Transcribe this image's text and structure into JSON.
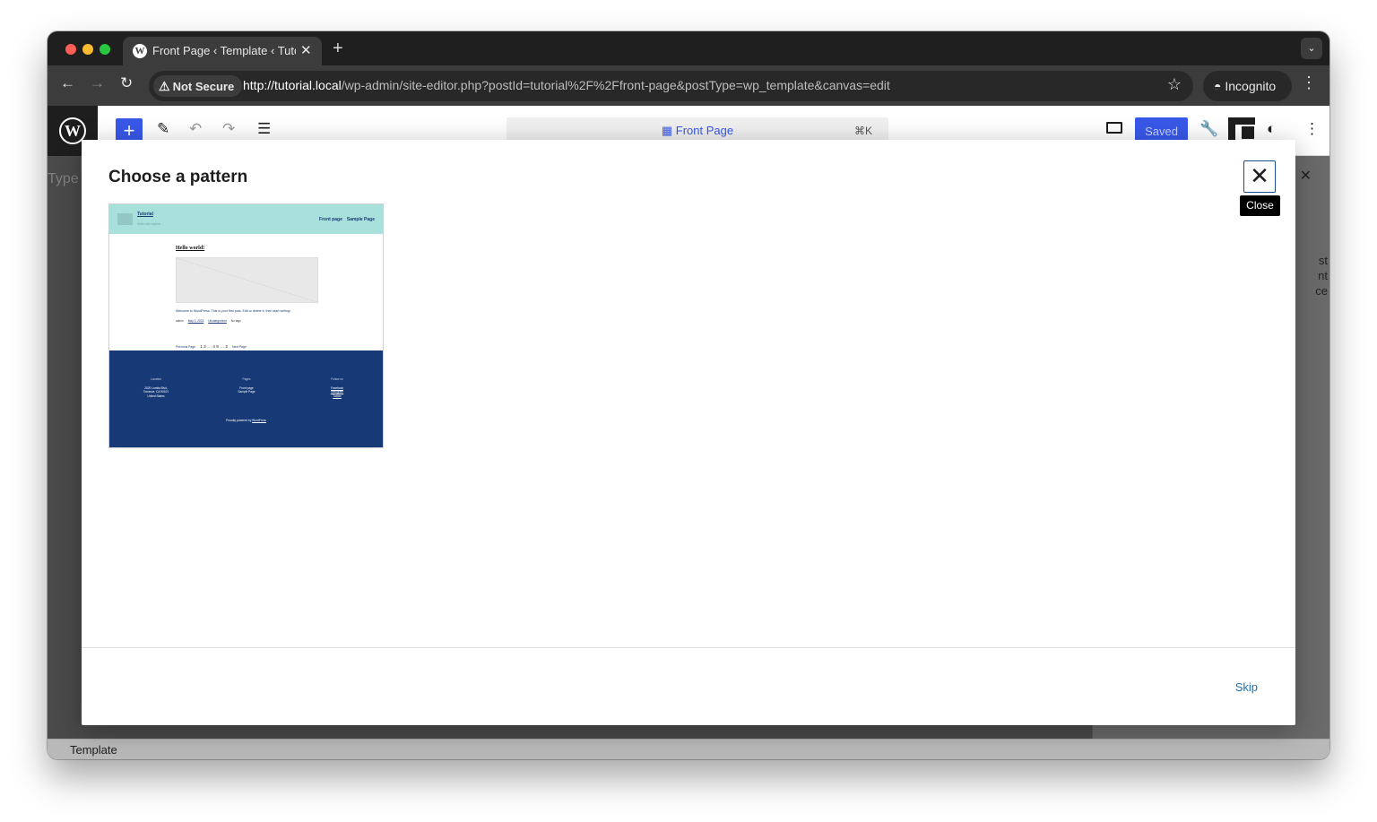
{
  "browser": {
    "tab_title": "Front Page ‹ Template ‹ Tutor",
    "tab_close": "✕",
    "new_tab": "+",
    "security_label": "Not Secure",
    "url_host": "http://tutorial.local",
    "url_path": "/wp-admin/site-editor.php?postId=tutorial%2F%2Ffront-page&postType=wp_template&canvas=edit",
    "profile_label": "Incognito"
  },
  "editor": {
    "command_title": "Front Page",
    "command_shortcut": "⌘K",
    "save_label": "Saved",
    "type_hint": "Type",
    "sidebar_text": [
      "st",
      "nt",
      "ce"
    ],
    "statusbar_label": "Template"
  },
  "modal": {
    "title": "Choose a pattern",
    "close_tooltip": "Close",
    "skip_label": "Skip"
  },
  "pattern_preview": {
    "site_title": "Tutorial",
    "tagline": "Write site tagline...",
    "nav_items": [
      "Front page",
      "Sample Page"
    ],
    "post_title": "Hello world!",
    "excerpt": "Welcome to WordPress. This is your first post. Edit or delete it, then start writing!",
    "meta_author": "admin",
    "meta_date": "May 3, 2024",
    "meta_category": "Uncategorized",
    "meta_tags": "No tags",
    "pager_prev": "Previous Page",
    "pager_numbers": "1 2 … 4 5 … 2",
    "pager_next": "Next Page",
    "footer_location_head": "Location",
    "footer_location_lines": [
      "2020 Lomita Blvd,",
      "Torrance, CA 90101",
      "United States"
    ],
    "footer_pages_head": "Pages",
    "footer_pages_items": [
      "Front page",
      "Sample Page"
    ],
    "footer_follow_head": "Follow us",
    "footer_follow_items": [
      "Facebook",
      "Instagram",
      "Twitter"
    ],
    "powered_prefix": "Proudly powered by ",
    "powered_link": "WordPress"
  }
}
